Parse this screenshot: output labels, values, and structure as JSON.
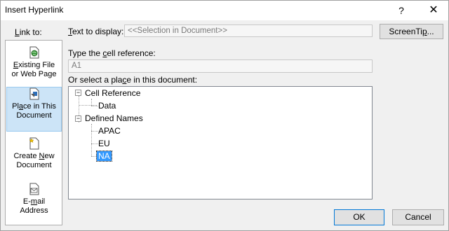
{
  "window": {
    "title": "Insert Hyperlink",
    "help_glyph": "?",
    "close_glyph": "✕"
  },
  "link_to": {
    "label_u": "L",
    "label_rest": "ink to:",
    "items": [
      {
        "pre": "",
        "u": "E",
        "post": "xisting File",
        "line2": "or Web Page",
        "icon": "globe-doc-icon"
      },
      {
        "pre": "Pl",
        "u": "a",
        "post": "ce in This",
        "line2": "Document",
        "icon": "place-doc-icon"
      },
      {
        "pre": "Create ",
        "u": "N",
        "post": "ew",
        "line2": "Document",
        "icon": "new-doc-icon"
      },
      {
        "pre": "E-",
        "u": "m",
        "post": "ail",
        "line2": "Address",
        "icon": "email-icon"
      }
    ]
  },
  "text_to_display": {
    "label_u": "T",
    "label_rest": "ext to display:",
    "value": "<<Selection in Document>>"
  },
  "screentip_button": {
    "pre": "ScreenTi",
    "u": "p",
    "post": "..."
  },
  "cell_reference": {
    "label_pre": "Type the ",
    "label_u": "c",
    "label_post": "ell reference:",
    "value": "A1"
  },
  "place_section": {
    "label_pre": "Or select a pla",
    "label_u": "c",
    "label_post": "e in this document:"
  },
  "tree": {
    "cell_reference_group": "Cell Reference",
    "cell_reference_items": [
      "Data"
    ],
    "defined_names_group": "Defined Names",
    "defined_names_items": [
      "APAC",
      "EU",
      "NA"
    ],
    "selected": "NA",
    "collapse_glyph": "−"
  },
  "buttons": {
    "ok": "OK",
    "cancel": "Cancel"
  }
}
